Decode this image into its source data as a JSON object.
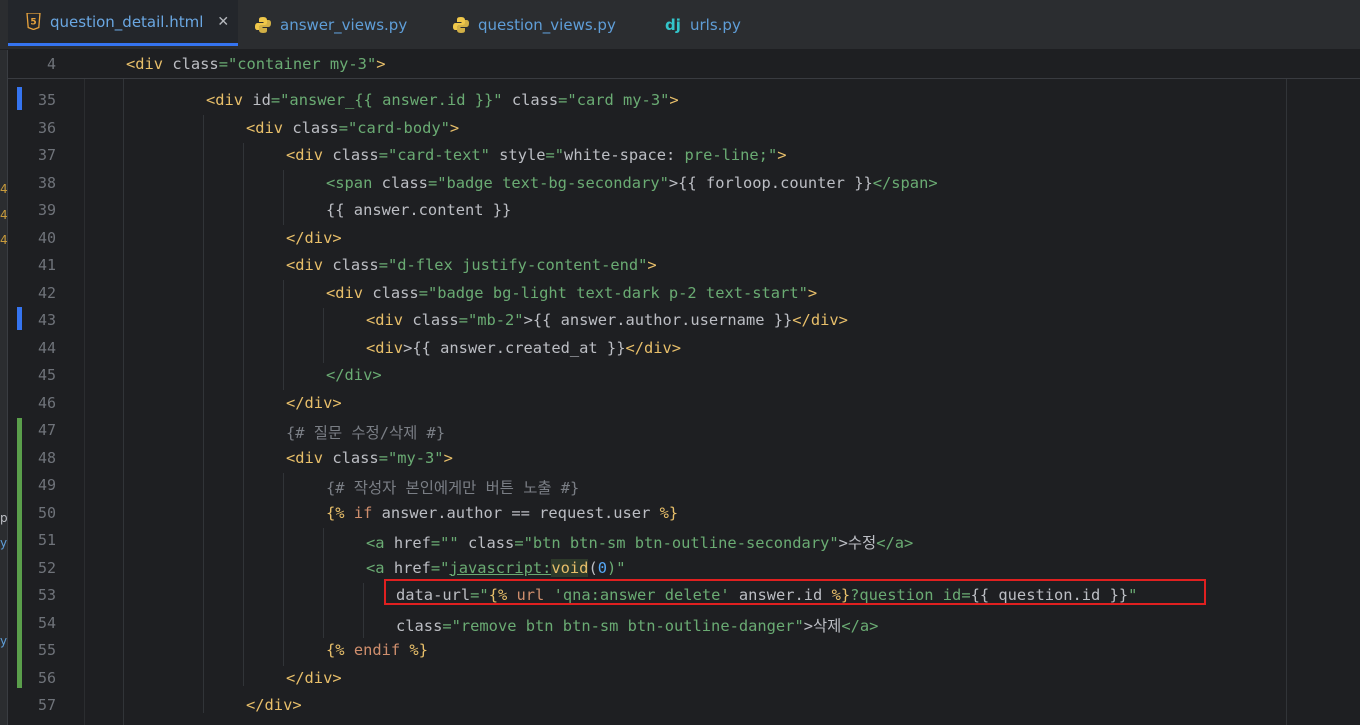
{
  "tabs": [
    {
      "label": "question_detail.html",
      "icon": "html5-icon",
      "active": true,
      "closable": true
    },
    {
      "label": "answer_views.py",
      "icon": "python-icon",
      "active": false
    },
    {
      "label": "question_views.py",
      "icon": "python-icon",
      "active": false
    },
    {
      "label": "urls.py",
      "icon": "django-icon",
      "active": false
    }
  ],
  "sticky_header": {
    "line_number": "4"
  },
  "lines": [
    {
      "n": "35"
    },
    {
      "n": "36"
    },
    {
      "n": "37"
    },
    {
      "n": "38"
    },
    {
      "n": "39"
    },
    {
      "n": "40"
    },
    {
      "n": "41"
    },
    {
      "n": "42"
    },
    {
      "n": "43"
    },
    {
      "n": "44"
    },
    {
      "n": "45"
    },
    {
      "n": "46"
    },
    {
      "n": "47"
    },
    {
      "n": "48"
    },
    {
      "n": "49"
    },
    {
      "n": "50"
    },
    {
      "n": "51"
    },
    {
      "n": "52"
    },
    {
      "n": "53"
    },
    {
      "n": "54"
    },
    {
      "n": "55"
    },
    {
      "n": "56"
    },
    {
      "n": "57"
    }
  ],
  "left_edge_marks": [
    "4",
    "4",
    "4",
    "p",
    "y",
    "y"
  ],
  "code": {
    "l4": [
      "<div",
      " class",
      "=\"container my-3\"",
      ">"
    ],
    "l35": [
      "<div",
      " id",
      "=\"answer_{{ answer.id }}\"",
      " class",
      "=\"card my-3\"",
      ">"
    ],
    "l36": [
      "<div",
      " class",
      "=\"card-body\"",
      ">"
    ],
    "l37": [
      "<div",
      " class",
      "=\"card-text\"",
      " style",
      "=\"",
      "white-space",
      ": ",
      "pre-line",
      ";\"",
      ">"
    ],
    "l38": [
      "<span",
      " class",
      "=\"badge text-bg-secondary\"",
      ">{{ forloop.counter }}",
      "</span>"
    ],
    "l39": [
      "{{ answer.content }}"
    ],
    "l40": [
      "</div>"
    ],
    "l41": [
      "<div",
      " class",
      "=\"d-flex justify-content-end\"",
      ">"
    ],
    "l42": [
      "<div",
      " class",
      "=\"badge bg-light text-dark p-2 text-start\"",
      ">"
    ],
    "l43": [
      "<div",
      " class",
      "=\"mb-2\"",
      ">{{ answer.author.username }}",
      "</div>"
    ],
    "l44": [
      "<div",
      ">{{ answer.created_at }}",
      "</div>"
    ],
    "l45": [
      "</div>"
    ],
    "l46": [
      "</div>"
    ],
    "l47": [
      "{# 질문 수정/삭제 #}"
    ],
    "l48": [
      "<div",
      " class",
      "=\"my-3\"",
      ">"
    ],
    "l49": [
      "{# 작성자 본인에게만 버튼 노출 #}"
    ],
    "l50": [
      "{%",
      " if",
      " answer.author == request.user ",
      "%}"
    ],
    "l51": [
      "<a",
      " href",
      "=\"\"",
      " class",
      "=\"btn btn-sm btn-outline-secondary\"",
      ">수정",
      "</a>"
    ],
    "l52": [
      "<a",
      " href",
      "=\"",
      "javascript:",
      "void",
      "(",
      "0",
      ")\""
    ],
    "l53": [
      "data-url",
      "=\"",
      "{%",
      " url ",
      "'qna:answer_delete'",
      " answer.id ",
      "%}",
      "?question_id=",
      "{{ question.id }}",
      "\""
    ],
    "l54": [
      "class",
      "=\"remove btn btn-sm btn-outline-danger\"",
      ">삭제",
      "</a>"
    ],
    "l55": [
      "{%",
      " endif ",
      "%}"
    ],
    "l56": [
      "</div>"
    ],
    "l57": [
      "</div>"
    ]
  },
  "colors": {
    "tag": "#e8bf6a",
    "string": "#6aab73",
    "comment": "#7a7e85",
    "template": "#cf8e6d",
    "highlight_box": "#e02020",
    "vcs_modified": "#3574f0",
    "vcs_added": "#5a9e4b"
  }
}
